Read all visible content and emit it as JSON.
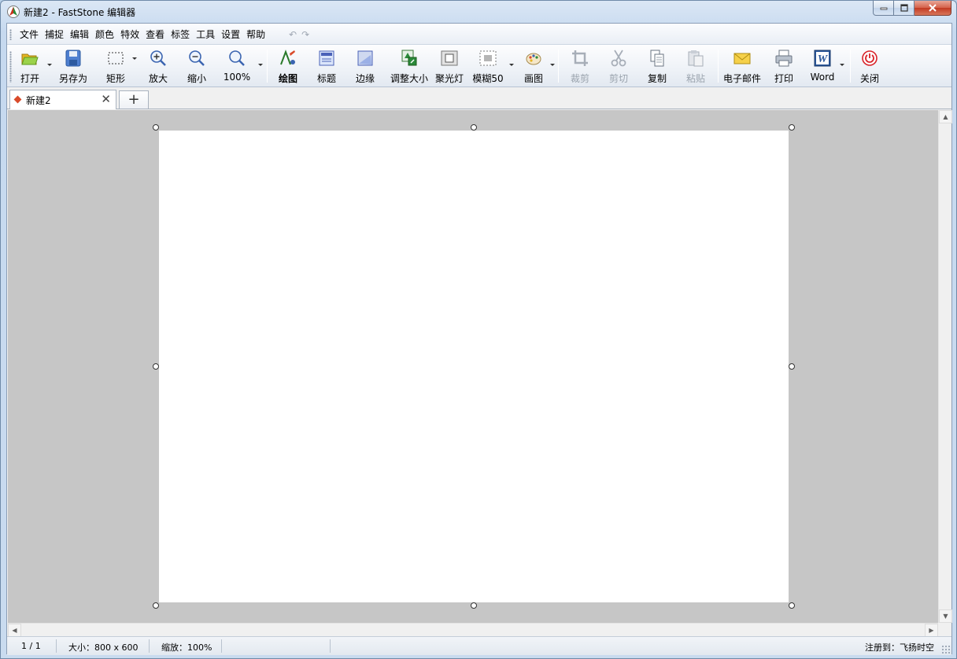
{
  "window": {
    "title": "新建2 - FastStone 编辑器"
  },
  "menu": {
    "items": [
      "文件",
      "捕捉",
      "编辑",
      "颜色",
      "特效",
      "查看",
      "标签",
      "工具",
      "设置",
      "帮助"
    ],
    "undo_icon": "undo-icon",
    "redo_icon": "redo-icon"
  },
  "toolbar": {
    "open": "打开",
    "save_as": "另存为",
    "rect_select": "矩形",
    "zoom_in": "放大",
    "zoom_out": "缩小",
    "zoom_level": "100%",
    "draw": "绘图",
    "caption": "标题",
    "edge": "边缘",
    "resize": "调整大小",
    "spotlight": "聚光灯",
    "blur": "模糊50",
    "canvas": "画图",
    "crop": "裁剪",
    "cut": "剪切",
    "copy": "复制",
    "paste": "粘贴",
    "email": "电子邮件",
    "print": "打印",
    "word": "Word",
    "close": "关闭"
  },
  "tabs": {
    "active_label": "新建2",
    "add_label": "+"
  },
  "status": {
    "page": "1 / 1",
    "size": "大小：800 x 600",
    "zoom": "缩放：100%",
    "registered": "注册到：飞扬时空"
  },
  "colors": {
    "canvas_bg": "#c6c6c6",
    "page_bg": "#ffffff",
    "accent_red": "#d94a2a"
  }
}
